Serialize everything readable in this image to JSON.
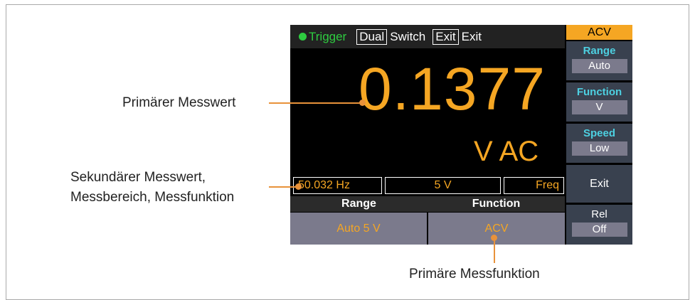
{
  "annotations": {
    "primary_value": "Primärer Messwert",
    "secondary_line1": "Sekundärer Messwert,",
    "secondary_line2": "Messbereich, Messfunktion",
    "primary_function": "Primäre Messfunktion"
  },
  "screen": {
    "topbar": {
      "trigger": "Trigger",
      "dual": "Dual",
      "switch": "Switch",
      "exit_key": "Exit",
      "exit_label": "Exit"
    },
    "main_value": "0.1377",
    "unit": "V AC",
    "secondary": {
      "freq_value": "50.032 Hz",
      "range": "5 V",
      "function": "Freq"
    },
    "bottom": {
      "range_label": "Range",
      "function_label": "Function",
      "range_value": "Auto 5 V",
      "function_value": "ACV"
    }
  },
  "softkeys": {
    "mode": "ACV",
    "range_title": "Range",
    "range_value": "Auto",
    "function_title": "Function",
    "function_value": "V",
    "speed_title": "Speed",
    "speed_value": "Low",
    "exit": "Exit",
    "rel_title": "Rel",
    "rel_value": "Off"
  },
  "colors": {
    "accent_orange": "#f5a623",
    "trigger_green": "#2ecc40",
    "softkey_title_cyan": "#4dd0e1",
    "annotation_line": "#e8923a"
  }
}
